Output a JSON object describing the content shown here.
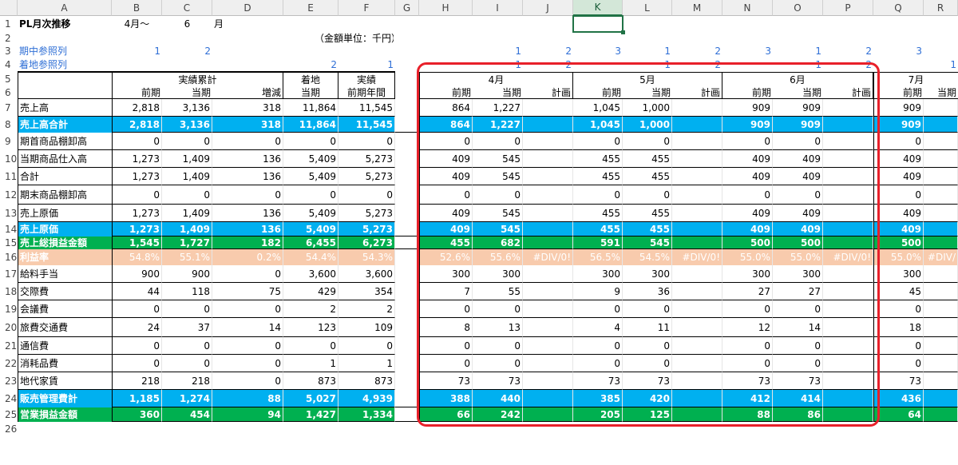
{
  "column_letters": [
    "A",
    "B",
    "C",
    "D",
    "E",
    "F",
    "G",
    "H",
    "I",
    "J",
    "K",
    "L",
    "M",
    "N",
    "O",
    "P",
    "Q",
    "R"
  ],
  "header": {
    "a1": "PL月次推移",
    "b1": "4月～",
    "c1": "6",
    "d1": "月",
    "unit_note": "（金額単位：千円）",
    "a3": "期中参照列",
    "a4": "着地参照列",
    "ref_row3": [
      "1",
      "2",
      "",
      "",
      "",
      "",
      "",
      "1",
      "2",
      "3",
      "1",
      "2",
      "3",
      "1",
      "2",
      "3",
      "",
      ""
    ],
    "ref_row4": [
      "",
      "",
      "",
      "2",
      "1",
      "",
      "",
      "1",
      "2",
      "",
      "1",
      "2",
      "",
      "1",
      "2",
      "",
      "1",
      ""
    ]
  },
  "groups": {
    "actual_cum": "実績累計",
    "landing": "着地",
    "actual": "実績",
    "m4": "4月",
    "m5": "5月",
    "m6": "6月",
    "m7": "7月"
  },
  "subheaders": [
    "前期",
    "当期",
    "増減",
    "当期",
    "前期年間",
    "",
    "前期",
    "当期",
    "計画",
    "前期",
    "当期",
    "計画",
    "前期",
    "当期",
    "計画",
    "前期",
    "当期"
  ],
  "rows": [
    {
      "n": "7",
      "label": "売上高",
      "style": "",
      "vals": [
        "2,818",
        "3,136",
        "318",
        "11,864",
        "11,545",
        "",
        "864",
        "1,227",
        "",
        "1,045",
        "1,000",
        "",
        "909",
        "909",
        "",
        "909",
        ""
      ]
    },
    {
      "n": "8",
      "label": "売上高合計",
      "style": "blue",
      "vals": [
        "2,818",
        "3,136",
        "318",
        "11,864",
        "11,545",
        "",
        "864",
        "1,227",
        "",
        "1,045",
        "1,000",
        "",
        "909",
        "909",
        "",
        "909",
        ""
      ]
    },
    {
      "n": "9",
      "label": "期首商品棚卸高",
      "style": "",
      "vals": [
        "0",
        "0",
        "0",
        "0",
        "0",
        "",
        "0",
        "0",
        "",
        "0",
        "0",
        "",
        "0",
        "0",
        "",
        "0",
        ""
      ]
    },
    {
      "n": "10",
      "label": "当期商品仕入高",
      "style": "",
      "vals": [
        "1,273",
        "1,409",
        "136",
        "5,409",
        "5,273",
        "",
        "409",
        "545",
        "",
        "455",
        "455",
        "",
        "409",
        "409",
        "",
        "409",
        ""
      ]
    },
    {
      "n": "11",
      "label": "合計",
      "style": "",
      "vals": [
        "1,273",
        "1,409",
        "136",
        "5,409",
        "5,273",
        "",
        "409",
        "545",
        "",
        "455",
        "455",
        "",
        "409",
        "409",
        "",
        "409",
        ""
      ]
    },
    {
      "n": "12",
      "label": "期末商品棚卸高",
      "style": "",
      "vals": [
        "0",
        "0",
        "0",
        "0",
        "0",
        "",
        "0",
        "0",
        "",
        "0",
        "0",
        "",
        "0",
        "0",
        "",
        "0",
        ""
      ]
    },
    {
      "n": "13",
      "label": "売上原価",
      "style": "",
      "vals": [
        "1,273",
        "1,409",
        "136",
        "5,409",
        "5,273",
        "",
        "409",
        "545",
        "",
        "455",
        "455",
        "",
        "409",
        "409",
        "",
        "409",
        ""
      ]
    },
    {
      "n": "14",
      "label": "売上原価",
      "style": "blue",
      "vals": [
        "1,273",
        "1,409",
        "136",
        "5,409",
        "5,273",
        "",
        "409",
        "545",
        "",
        "455",
        "455",
        "",
        "409",
        "409",
        "",
        "409",
        ""
      ]
    },
    {
      "n": "15",
      "label": "売上総損益金額",
      "style": "green",
      "vals": [
        "1,545",
        "1,727",
        "182",
        "6,455",
        "6,273",
        "",
        "455",
        "682",
        "",
        "591",
        "545",
        "",
        "500",
        "500",
        "",
        "500",
        ""
      ]
    },
    {
      "n": "16",
      "label": "利益率",
      "style": "peach",
      "vals": [
        "54.8%",
        "55.1%",
        "0.2%",
        "54.4%",
        "54.3%",
        "",
        "52.6%",
        "55.6%",
        "#DIV/0!",
        "56.5%",
        "54.5%",
        "#DIV/0!",
        "55.0%",
        "55.0%",
        "#DIV/0!",
        "55.0%",
        "#DIV/"
      ]
    },
    {
      "n": "17",
      "label": "給料手当",
      "style": "",
      "vals": [
        "900",
        "900",
        "0",
        "3,600",
        "3,600",
        "",
        "300",
        "300",
        "",
        "300",
        "300",
        "",
        "300",
        "300",
        "",
        "300",
        ""
      ]
    },
    {
      "n": "18",
      "label": "交際費",
      "style": "",
      "vals": [
        "44",
        "118",
        "75",
        "429",
        "354",
        "",
        "7",
        "55",
        "",
        "9",
        "36",
        "",
        "27",
        "27",
        "",
        "45",
        ""
      ]
    },
    {
      "n": "19",
      "label": "会議費",
      "style": "",
      "vals": [
        "0",
        "0",
        "0",
        "2",
        "2",
        "",
        "0",
        "0",
        "",
        "0",
        "0",
        "",
        "0",
        "0",
        "",
        "0",
        ""
      ]
    },
    {
      "n": "20",
      "label": "旅費交通費",
      "style": "",
      "vals": [
        "24",
        "37",
        "14",
        "123",
        "109",
        "",
        "8",
        "13",
        "",
        "4",
        "11",
        "",
        "12",
        "14",
        "",
        "18",
        ""
      ]
    },
    {
      "n": "21",
      "label": "通信費",
      "style": "",
      "vals": [
        "0",
        "0",
        "0",
        "0",
        "0",
        "",
        "0",
        "0",
        "",
        "0",
        "0",
        "",
        "0",
        "0",
        "",
        "0",
        ""
      ]
    },
    {
      "n": "22",
      "label": "消耗品費",
      "style": "",
      "vals": [
        "0",
        "0",
        "0",
        "1",
        "1",
        "",
        "0",
        "0",
        "",
        "0",
        "0",
        "",
        "0",
        "0",
        "",
        "0",
        ""
      ]
    },
    {
      "n": "23",
      "label": "地代家賃",
      "style": "",
      "vals": [
        "218",
        "218",
        "0",
        "873",
        "873",
        "",
        "73",
        "73",
        "",
        "73",
        "73",
        "",
        "73",
        "73",
        "",
        "73",
        ""
      ]
    },
    {
      "n": "24",
      "label": "販売管理費計",
      "style": "blue",
      "vals": [
        "1,185",
        "1,274",
        "88",
        "5,027",
        "4,939",
        "",
        "388",
        "440",
        "",
        "385",
        "420",
        "",
        "412",
        "414",
        "",
        "436",
        ""
      ]
    },
    {
      "n": "25",
      "label": "営業損益金額",
      "style": "green",
      "vals": [
        "360",
        "454",
        "94",
        "1,427",
        "1,334",
        "",
        "66",
        "242",
        "",
        "205",
        "125",
        "",
        "88",
        "86",
        "",
        "64",
        ""
      ]
    }
  ],
  "row_numbers_top": [
    "1",
    "2",
    "3",
    "4",
    "5",
    "6"
  ],
  "row26": "26",
  "colors": {
    "blue": "#00b0f0",
    "green": "#00b050",
    "peach": "#f8cbad",
    "highlight": "#e8202a",
    "select": "#217346"
  }
}
